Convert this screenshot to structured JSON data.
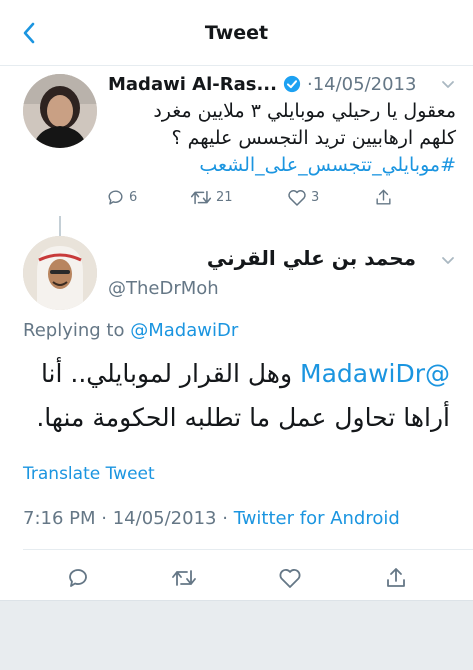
{
  "header": {
    "title": "Tweet"
  },
  "parent_tweet": {
    "author_name": "Madawi Al-Ras...",
    "separator": "·",
    "date": "14/05/2013",
    "text_line1": "معقول يا رحيلي موبايلي ٣ ملايين مغرد",
    "text_line2": "كلهم ارهابيين تريد التجسس عليهم ؟",
    "hashtag": "#موبايلي_تتجسس_على_الشعب",
    "stats": {
      "replies": "6",
      "retweets": "21",
      "likes": "3"
    }
  },
  "main_tweet": {
    "author_name": "محمد بن علي القرني",
    "handle": "@TheDrMoh",
    "replying_prefix": "Replying to",
    "replying_mention": "@MadawiDr",
    "text_mention": "@MadawiDr",
    "text_line1_rest": "وهل القرار لموبايلي.. أنا",
    "text_line2": "أراها تحاول عمل ما تطلبه الحكومة منها.",
    "translate_label": "Translate Tweet",
    "time": "7:16 PM",
    "date": "14/05/2013",
    "separator": "·",
    "client": "Twitter for Android"
  },
  "colors": {
    "accent": "#1b95e0",
    "muted": "#657786",
    "verified": "#1da1f2"
  }
}
